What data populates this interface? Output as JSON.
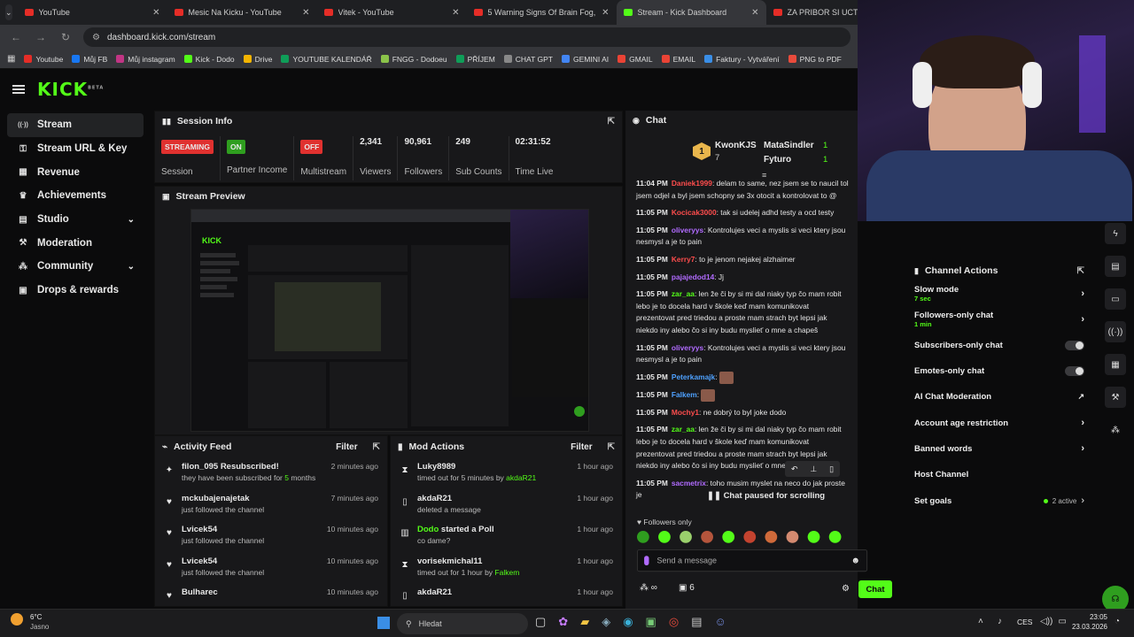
{
  "browser": {
    "tabs": [
      {
        "title": "YouTube",
        "active": false,
        "favicon": "youtube-icon"
      },
      {
        "title": "Mesic Na Kicku - YouTube",
        "active": false,
        "favicon": "youtube-icon"
      },
      {
        "title": "Vitek - YouTube",
        "active": false,
        "favicon": "youtube-icon"
      },
      {
        "title": "5 Warning Signs Of Brain Fog, I",
        "active": false,
        "favicon": "youtube-icon"
      },
      {
        "title": "Stream - Kick Dashboard",
        "active": true,
        "favicon": "kick-icon"
      },
      {
        "title": "ZA PRIBOR SI UCTUJI 150KC?! I",
        "active": false,
        "favicon": "youtube-icon"
      }
    ],
    "url": "dashboard.kick.com/stream",
    "bookmarks": [
      "Youtube",
      "Můj FB",
      "Můj instagram",
      "Kick - Dodo",
      "Drive",
      "YOUTUBE KALENDÁŘ",
      "FNGG - Dodoeu",
      "PŘÍJEM",
      "CHAT GPT",
      "GEMINI AI",
      "GMAIL",
      "EMAIL",
      "Faktury - Vytváření",
      "PNG to PDF"
    ]
  },
  "kick": {
    "logo": "KICK",
    "logo_badge": "BETA",
    "sidebar": [
      {
        "label": "Stream",
        "icon": "signal-icon",
        "active": true,
        "chevron": false
      },
      {
        "label": "Stream URL & Key",
        "icon": "key-icon",
        "active": false,
        "chevron": false
      },
      {
        "label": "Revenue",
        "icon": "revenue-icon",
        "active": false,
        "chevron": false
      },
      {
        "label": "Achievements",
        "icon": "trophy-icon",
        "active": false,
        "chevron": false
      },
      {
        "label": "Studio",
        "icon": "studio-icon",
        "active": false,
        "chevron": true
      },
      {
        "label": "Moderation",
        "icon": "wrench-icon",
        "active": false,
        "chevron": false
      },
      {
        "label": "Community",
        "icon": "community-icon",
        "active": false,
        "chevron": true
      },
      {
        "label": "Drops & rewards",
        "icon": "gift-icon",
        "active": false,
        "chevron": false
      }
    ]
  },
  "session": {
    "title": "Session Info",
    "stats": [
      {
        "value": "STREAMING",
        "label": "Session",
        "type": "pill",
        "color": "#e0312f"
      },
      {
        "value": "ON",
        "label": "Partner Income",
        "type": "pill",
        "color": "#2f9e1f"
      },
      {
        "value": "OFF",
        "label": "Multistream",
        "type": "pill",
        "color": "#e0312f"
      },
      {
        "value": "2,341",
        "label": "Viewers",
        "type": "num"
      },
      {
        "value": "90,961",
        "label": "Followers",
        "type": "num"
      },
      {
        "value": "249",
        "label": "Sub Counts",
        "type": "num"
      },
      {
        "value": "02:31:52",
        "label": "Time Live",
        "type": "num"
      }
    ]
  },
  "preview": {
    "title": "Stream Preview"
  },
  "activity": {
    "title": "Activity Feed",
    "filter": "Filter",
    "items": [
      {
        "icon": "sparkle-icon",
        "name": "filon_095 Resubscribed!",
        "sub": "they have been subscribed for 5 months",
        "time": "2 minutes ago"
      },
      {
        "icon": "heart-icon",
        "name": "mckubajenajetak",
        "sub": "just followed the channel",
        "time": "7 minutes ago"
      },
      {
        "icon": "heart-icon",
        "name": "Lvicek54",
        "sub": "just followed the channel",
        "time": "10 minutes ago"
      },
      {
        "icon": "heart-icon",
        "name": "Lvicek54",
        "sub": "just followed the channel",
        "time": "10 minutes ago"
      },
      {
        "icon": "heart-icon",
        "name": "Bulharec",
        "sub": "",
        "time": "10 minutes ago"
      }
    ]
  },
  "modactions": {
    "title": "Mod Actions",
    "filter": "Filter",
    "items": [
      {
        "icon": "hourglass-icon",
        "name": "Luky8989",
        "sub": "timed out for 5 minutes by akdaR21",
        "time": "1 hour ago"
      },
      {
        "icon": "trash-icon",
        "name": "akdaR21",
        "sub": "deleted a message",
        "time": "1 hour ago"
      },
      {
        "icon": "poll-icon",
        "name": "Dodo started a Poll",
        "sub": "co dame?",
        "time": "1 hour ago"
      },
      {
        "icon": "hourglass-icon",
        "name": "vorisekmichal11",
        "sub": "timed out for 1 hour by Falkem",
        "time": "1 hour ago"
      },
      {
        "icon": "trash-icon",
        "name": "akdaR21",
        "sub": "",
        "time": "1 hour ago"
      }
    ]
  },
  "chat": {
    "title": "Chat",
    "leaderboard": {
      "rank": "1",
      "leader": "KwonKJS",
      "leader_count": "7",
      "others": [
        {
          "name": "MataSindler",
          "count": "1"
        },
        {
          "name": "Fyturo",
          "count": "1"
        }
      ]
    },
    "messages": [
      {
        "time": "11:04 PM",
        "user": "Daniek1999",
        "uclass": "u3",
        "text": "delam to same, nez jsem se to naucil tol jsem odjel a byl jsem schopny se 3x otocit a kontrolovat to @"
      },
      {
        "time": "11:05 PM",
        "user": "Kocicak3000",
        "uclass": "u3",
        "text": "tak si udelej adhd testy a ocd testy"
      },
      {
        "time": "11:05 PM",
        "user": "oliveryys",
        "uclass": "u2",
        "text": "Kontrolujes veci a myslis si veci ktery jsou nesmysl a je to pain"
      },
      {
        "time": "11:05 PM",
        "user": "Kerry7",
        "uclass": "u3",
        "text": "to je jenom nejakej alzhaimer"
      },
      {
        "time": "11:05 PM",
        "user": "pajajedod14",
        "uclass": "u2",
        "text": "Jj"
      },
      {
        "time": "11:05 PM",
        "user": "zar_aa",
        "uclass": "u4",
        "text": "len že či by si mi dal niaky typ čo mam robit lebo je to docela hard v škole keď mam komunikovat prezentovat pred triedou a proste mam strach byt lepsi jak niekdo iny alebo čo si iny budu myslieť o mne a chapeš"
      },
      {
        "time": "11:05 PM",
        "user": "oliveryys",
        "uclass": "u2",
        "text": "Kontrolujes veci a myslis si veci ktery jsou nesmysl a je to pain"
      },
      {
        "time": "11:05 PM",
        "user": "Peterkamajk",
        "uclass": "u5",
        "text": ""
      },
      {
        "time": "11:05 PM",
        "user": "Falkem",
        "uclass": "u5",
        "text": ""
      },
      {
        "time": "11:05 PM",
        "user": "Mochy1",
        "uclass": "u3",
        "text": "ne dobrý to byl joke dodo"
      },
      {
        "time": "11:05 PM",
        "user": "zar_aa",
        "uclass": "u4",
        "text": "len že či by si mi dal niaky typ čo mam robit lebo je to docela hard v škole keď mam komunikovat prezentovat pred triedou a proste mam strach byt lepsi jak niekdo iny alebo čo si iny budu myslieť o mne a chapeš"
      },
      {
        "time": "11:05 PM",
        "user": "sacmetrix",
        "uclass": "u2",
        "text": "toho musim myslet na neco do jak proste je"
      }
    ],
    "paused": "Chat paused for scrolling",
    "followers_only": "Followers only",
    "placeholder": "Send a message",
    "bottom_count": "6",
    "send_label": "Chat"
  },
  "channel_actions": {
    "title": "Channel Actions",
    "items": [
      {
        "label": "Slow mode",
        "sub": "7 sec",
        "control": "chevron"
      },
      {
        "label": "Followers-only chat",
        "sub": "1 min",
        "control": "chevron"
      },
      {
        "label": "Subscribers-only chat",
        "sub": "",
        "control": "toggle"
      },
      {
        "label": "Emotes-only chat",
        "sub": "",
        "control": "toggle"
      },
      {
        "label": "AI Chat Moderation",
        "sub": "",
        "control": "external"
      },
      {
        "label": "Account age restriction",
        "sub": "",
        "control": "chevron"
      },
      {
        "label": "Banned words",
        "sub": "",
        "control": "chevron"
      },
      {
        "label": "Host Channel",
        "sub": "",
        "control": "none"
      },
      {
        "label": "Set goals",
        "sub": "",
        "control": "goals",
        "badge": "2 active"
      }
    ]
  },
  "taskbar": {
    "weather_temp": "6°C",
    "weather_desc": "Jasno",
    "search": "Hledat",
    "lang": "CES",
    "time": "23:05",
    "date": "23.03.2026"
  }
}
